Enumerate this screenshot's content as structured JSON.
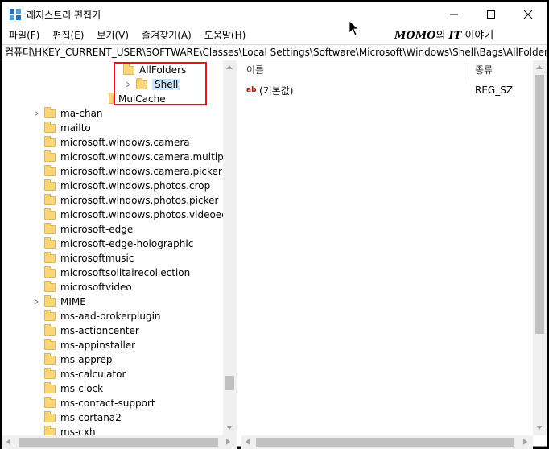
{
  "window": {
    "title": "레지스트리 편집기",
    "watermark_brand": "MOMO",
    "watermark_mid": "의",
    "watermark_it": "IT",
    "watermark_tail": "이야기"
  },
  "menu": [
    "파일(F)",
    "편집(E)",
    "보기(V)",
    "즐겨찾기(A)",
    "도움말(H)"
  ],
  "address": "컴퓨터\\HKEY_CURRENT_USER\\SOFTWARE\\Classes\\Local Settings\\Software\\Microsoft\\Windows\\Shell\\Bags\\AllFolders\\Shell",
  "tree": {
    "highlighted": [
      "AllFolders",
      "Shell",
      "MuiCache"
    ],
    "selected": "Shell",
    "items": [
      "ma-chan",
      "mailto",
      "microsoft.windows.camera",
      "microsoft.windows.camera.multipicker",
      "microsoft.windows.camera.picker",
      "microsoft.windows.photos.crop",
      "microsoft.windows.photos.picker",
      "microsoft.windows.photos.videoedit",
      "microsoft-edge",
      "microsoft-edge-holographic",
      "microsoftmusic",
      "microsoftsolitairecollection",
      "microsoftvideo",
      "MIME",
      "ms-aad-brokerplugin",
      "ms-actioncenter",
      "ms-appinstaller",
      "ms-apprep",
      "ms-calculator",
      "ms-clock",
      "ms-contact-support",
      "ms-cortana2",
      "ms-cxh"
    ],
    "expandable": [
      "ma-chan",
      "MIME"
    ]
  },
  "values": {
    "columns": [
      "이름",
      "종류"
    ],
    "rows": [
      {
        "name": "(기본값)",
        "type": "REG_SZ",
        "icon": "ab-string-icon"
      }
    ]
  },
  "colors": {
    "highlight_border": "#e8141b",
    "folder": "#f9d67a",
    "selection": "#cce8ff"
  }
}
